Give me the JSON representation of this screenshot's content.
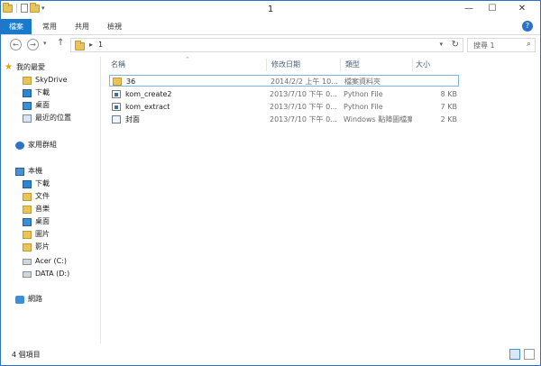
{
  "window": {
    "title": "1"
  },
  "quick_access": {
    "dropdown_glyph": "▾"
  },
  "window_controls": {
    "minimize": "—",
    "maximize": "☐",
    "close": "✕"
  },
  "ribbon": {
    "tabs": [
      "檔案",
      "常用",
      "共用",
      "檢視"
    ],
    "help": "?"
  },
  "address": {
    "back": "←",
    "forward": "→",
    "history": "▾",
    "up": "↑",
    "separator": "▸",
    "path": "1",
    "dropdown": "▾",
    "refresh": "↻"
  },
  "search": {
    "placeholder": "搜尋 1",
    "icon": "⌕"
  },
  "nav_pane": {
    "favorites": {
      "label": "我的最愛",
      "items": [
        "SkyDrive",
        "下載",
        "桌面",
        "最近的位置"
      ]
    },
    "homegroup": {
      "label": "家用群組"
    },
    "this_pc": {
      "label": "本機",
      "items": [
        "下載",
        "文件",
        "音樂",
        "桌面",
        "圖片",
        "影片",
        "Acer (C:)",
        "DATA (D:)"
      ]
    },
    "network": {
      "label": "網路"
    }
  },
  "columns": {
    "name": "名稱",
    "date": "修改日期",
    "type": "類型",
    "size": "大小"
  },
  "files": [
    {
      "name": "36",
      "date": "2014/2/2 上午 10...",
      "type": "檔案資料夾",
      "size": "",
      "icon": "folder-icon"
    },
    {
      "name": "kom_create2",
      "date": "2013/7/10 下午 0...",
      "type": "Python File",
      "size": "8 KB",
      "icon": "python-file-icon"
    },
    {
      "name": "kom_extract",
      "date": "2013/7/10 下午 0...",
      "type": "Python File",
      "size": "7 KB",
      "icon": "python-file-icon"
    },
    {
      "name": "封面",
      "date": "2013/7/10 下午 0...",
      "type": "Windows 點陣圖檔案",
      "size": "2 KB",
      "icon": "bitmap-icon"
    }
  ],
  "status": {
    "item_count": "4 個項目"
  },
  "colors": {
    "accent": "#1979ca",
    "border": "#2a73c9",
    "selection": "#7fb4e6",
    "folder": "#e8c45a"
  }
}
